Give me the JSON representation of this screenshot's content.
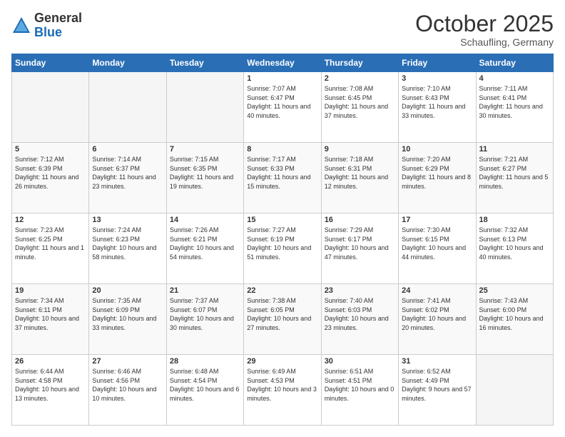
{
  "header": {
    "logo_general": "General",
    "logo_blue": "Blue",
    "month": "October 2025",
    "location": "Schaufling, Germany"
  },
  "days_of_week": [
    "Sunday",
    "Monday",
    "Tuesday",
    "Wednesday",
    "Thursday",
    "Friday",
    "Saturday"
  ],
  "weeks": [
    [
      {
        "day": "",
        "empty": true
      },
      {
        "day": "",
        "empty": true
      },
      {
        "day": "",
        "empty": true
      },
      {
        "day": "1",
        "sunrise": "7:07 AM",
        "sunset": "6:47 PM",
        "daylight": "11 hours and 40 minutes."
      },
      {
        "day": "2",
        "sunrise": "7:08 AM",
        "sunset": "6:45 PM",
        "daylight": "11 hours and 37 minutes."
      },
      {
        "day": "3",
        "sunrise": "7:10 AM",
        "sunset": "6:43 PM",
        "daylight": "11 hours and 33 minutes."
      },
      {
        "day": "4",
        "sunrise": "7:11 AM",
        "sunset": "6:41 PM",
        "daylight": "11 hours and 30 minutes."
      }
    ],
    [
      {
        "day": "5",
        "sunrise": "7:12 AM",
        "sunset": "6:39 PM",
        "daylight": "11 hours and 26 minutes."
      },
      {
        "day": "6",
        "sunrise": "7:14 AM",
        "sunset": "6:37 PM",
        "daylight": "11 hours and 23 minutes."
      },
      {
        "day": "7",
        "sunrise": "7:15 AM",
        "sunset": "6:35 PM",
        "daylight": "11 hours and 19 minutes."
      },
      {
        "day": "8",
        "sunrise": "7:17 AM",
        "sunset": "6:33 PM",
        "daylight": "11 hours and 15 minutes."
      },
      {
        "day": "9",
        "sunrise": "7:18 AM",
        "sunset": "6:31 PM",
        "daylight": "11 hours and 12 minutes."
      },
      {
        "day": "10",
        "sunrise": "7:20 AM",
        "sunset": "6:29 PM",
        "daylight": "11 hours and 8 minutes."
      },
      {
        "day": "11",
        "sunrise": "7:21 AM",
        "sunset": "6:27 PM",
        "daylight": "11 hours and 5 minutes."
      }
    ],
    [
      {
        "day": "12",
        "sunrise": "7:23 AM",
        "sunset": "6:25 PM",
        "daylight": "11 hours and 1 minute."
      },
      {
        "day": "13",
        "sunrise": "7:24 AM",
        "sunset": "6:23 PM",
        "daylight": "10 hours and 58 minutes."
      },
      {
        "day": "14",
        "sunrise": "7:26 AM",
        "sunset": "6:21 PM",
        "daylight": "10 hours and 54 minutes."
      },
      {
        "day": "15",
        "sunrise": "7:27 AM",
        "sunset": "6:19 PM",
        "daylight": "10 hours and 51 minutes."
      },
      {
        "day": "16",
        "sunrise": "7:29 AM",
        "sunset": "6:17 PM",
        "daylight": "10 hours and 47 minutes."
      },
      {
        "day": "17",
        "sunrise": "7:30 AM",
        "sunset": "6:15 PM",
        "daylight": "10 hours and 44 minutes."
      },
      {
        "day": "18",
        "sunrise": "7:32 AM",
        "sunset": "6:13 PM",
        "daylight": "10 hours and 40 minutes."
      }
    ],
    [
      {
        "day": "19",
        "sunrise": "7:34 AM",
        "sunset": "6:11 PM",
        "daylight": "10 hours and 37 minutes."
      },
      {
        "day": "20",
        "sunrise": "7:35 AM",
        "sunset": "6:09 PM",
        "daylight": "10 hours and 33 minutes."
      },
      {
        "day": "21",
        "sunrise": "7:37 AM",
        "sunset": "6:07 PM",
        "daylight": "10 hours and 30 minutes."
      },
      {
        "day": "22",
        "sunrise": "7:38 AM",
        "sunset": "6:05 PM",
        "daylight": "10 hours and 27 minutes."
      },
      {
        "day": "23",
        "sunrise": "7:40 AM",
        "sunset": "6:03 PM",
        "daylight": "10 hours and 23 minutes."
      },
      {
        "day": "24",
        "sunrise": "7:41 AM",
        "sunset": "6:02 PM",
        "daylight": "10 hours and 20 minutes."
      },
      {
        "day": "25",
        "sunrise": "7:43 AM",
        "sunset": "6:00 PM",
        "daylight": "10 hours and 16 minutes."
      }
    ],
    [
      {
        "day": "26",
        "sunrise": "6:44 AM",
        "sunset": "4:58 PM",
        "daylight": "10 hours and 13 minutes."
      },
      {
        "day": "27",
        "sunrise": "6:46 AM",
        "sunset": "4:56 PM",
        "daylight": "10 hours and 10 minutes."
      },
      {
        "day": "28",
        "sunrise": "6:48 AM",
        "sunset": "4:54 PM",
        "daylight": "10 hours and 6 minutes."
      },
      {
        "day": "29",
        "sunrise": "6:49 AM",
        "sunset": "4:53 PM",
        "daylight": "10 hours and 3 minutes."
      },
      {
        "day": "30",
        "sunrise": "6:51 AM",
        "sunset": "4:51 PM",
        "daylight": "10 hours and 0 minutes."
      },
      {
        "day": "31",
        "sunrise": "6:52 AM",
        "sunset": "4:49 PM",
        "daylight": "9 hours and 57 minutes."
      },
      {
        "day": "",
        "empty": true
      }
    ]
  ]
}
